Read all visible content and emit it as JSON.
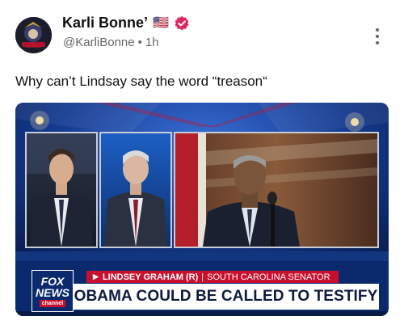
{
  "post": {
    "author": {
      "display_name": "Karli Bonne’",
      "flag": "🇺🇸",
      "handle": "@KarliBonne",
      "separator": "•",
      "time": "1h",
      "verified_color": "#e0245e"
    },
    "text": "Why can’t Lindsay say the word “treason“"
  },
  "media": {
    "network_logo": {
      "line1": "FOX",
      "line2": "NEWS",
      "line3": "channel"
    },
    "chyron_name": "LINDSEY GRAHAM (R)",
    "chyron_separator": "|",
    "chyron_role": "SOUTH CAROLINA SENATOR",
    "headline": "OBAMA COULD BE CALLED TO TESTIFY"
  },
  "icons": {
    "verified": "verified-badge-icon",
    "more": "more-options-icon"
  },
  "colors": {
    "accent_red": "#c8102e",
    "fox_blue": "#0b2a6e",
    "verified_red": "#e0245e"
  }
}
